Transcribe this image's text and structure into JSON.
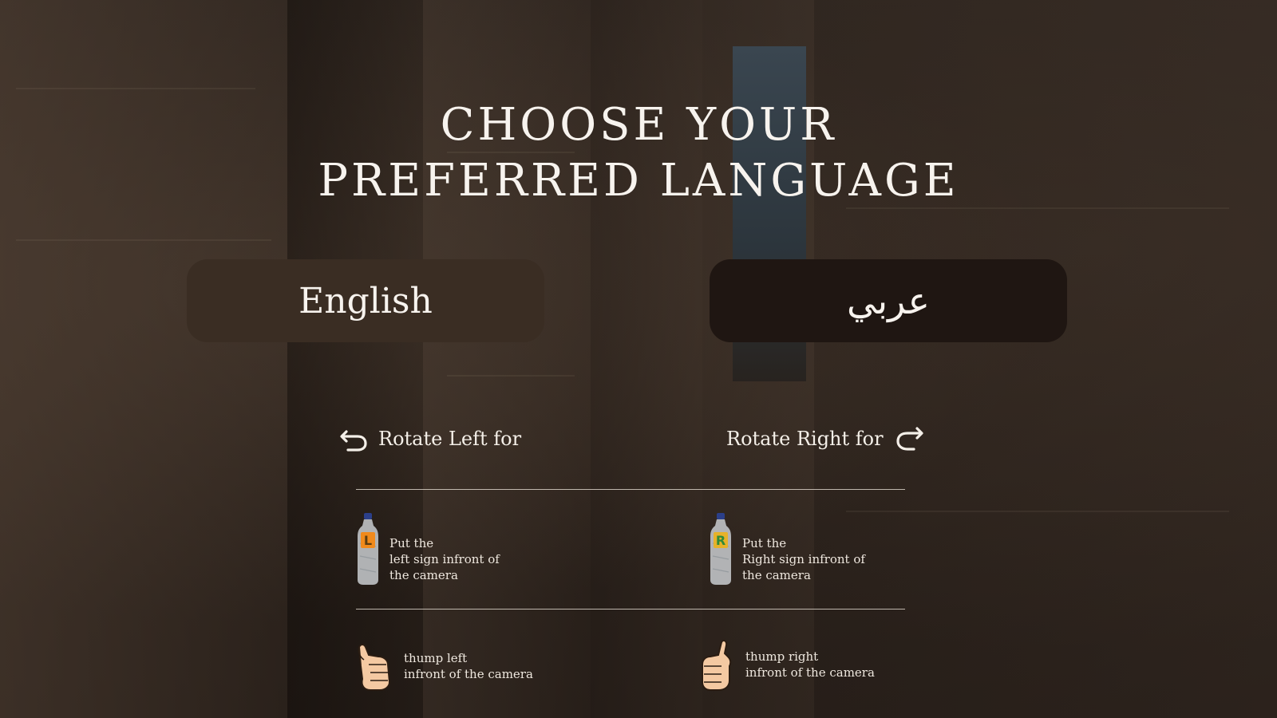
{
  "title": {
    "line1": "CHOOSE YOUR",
    "line2": "PREFERRED LANGUAGE"
  },
  "languages": {
    "english": "English",
    "arabic": "عربي"
  },
  "rotate": {
    "left_label": "Rotate Left for",
    "right_label": "Rotate Right for"
  },
  "bottle_hints": {
    "left": {
      "letter": "L",
      "lines": [
        "Put the",
        "left sign infront of",
        "the camera"
      ]
    },
    "right": {
      "letter": "R",
      "lines": [
        "Put the",
        "Right sign infront of",
        "the camera"
      ]
    }
  },
  "thumb_hints": {
    "left": {
      "lines": [
        "thump left",
        "infront of the camera"
      ]
    },
    "right": {
      "lines": [
        "thump right",
        "infront of the camera"
      ]
    }
  },
  "icons": {
    "rotate_left": "rotate-left-icon",
    "rotate_right": "rotate-right-icon",
    "bottle": "water-bottle-icon",
    "thumb": "thumbs-up-icon"
  },
  "colors": {
    "english_button": "#3a2d23",
    "arabic_button": "#1f1612",
    "text": "#f7f3ee"
  }
}
